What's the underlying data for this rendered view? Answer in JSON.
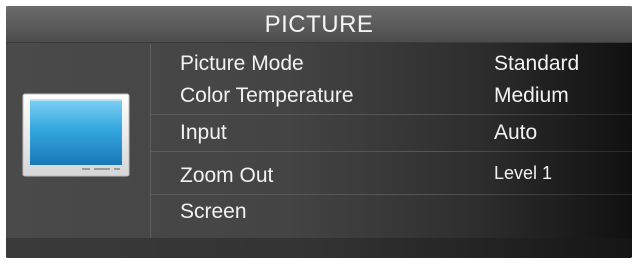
{
  "menu": {
    "title": "PICTURE",
    "icon": "tv-icon",
    "items": [
      {
        "label": "Picture Mode",
        "value": "Standard"
      },
      {
        "label": "Color Temperature",
        "value": "Medium"
      },
      {
        "label": "Input",
        "value": "Auto"
      },
      {
        "label": "Zoom Out",
        "value": "Level 1"
      },
      {
        "label": "Screen",
        "value": ""
      }
    ]
  },
  "colors": {
    "background": "#444444",
    "title_bar": "#5b5b5b",
    "text": "#f2f2f2",
    "screen_blue": "#2f9ed8"
  }
}
